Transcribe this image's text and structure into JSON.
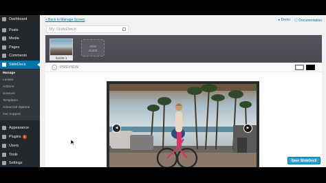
{
  "sidebar": {
    "items": [
      {
        "label": "Dashboard",
        "icon": "dashboard-icon"
      },
      {
        "label": "Posts",
        "icon": "pin-icon"
      },
      {
        "label": "Media",
        "icon": "media-icon"
      },
      {
        "label": "Pages",
        "icon": "pages-icon"
      },
      {
        "label": "Comments",
        "icon": "comments-icon"
      },
      {
        "label": "SlideDeck",
        "icon": "slidedeck-icon",
        "active": true
      },
      {
        "label": "Appearance",
        "icon": "brush-icon"
      },
      {
        "label": "Plugins",
        "icon": "plugin-icon",
        "badge": "1"
      },
      {
        "label": "Users",
        "icon": "users-icon"
      },
      {
        "label": "Tools",
        "icon": "wrench-icon"
      },
      {
        "label": "Settings",
        "icon": "settings-icon"
      }
    ],
    "submenu": [
      "Manage",
      "Lenses",
      "Addons",
      "Sources",
      "Templates",
      "Advanced Options",
      "Get Support"
    ]
  },
  "header": {
    "back_link": "« Back to Manage Screen",
    "demo": "Demo",
    "documentation": "Documentation"
  },
  "editor": {
    "title_placeholder": "My SlideDeck",
    "slide_label": "SLIDE 1",
    "add_slide_line1": "ADD",
    "add_slide_line2": "SLIDE",
    "preview_label": "PREVIEW",
    "save_label": "Save SlideDeck"
  },
  "colors": {
    "accent": "#0073aa",
    "save_button": "#2ea2cc",
    "sidebar_bg": "#23282d",
    "slide_bar": "#4e4b57"
  }
}
